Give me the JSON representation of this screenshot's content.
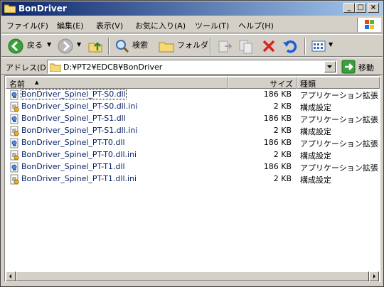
{
  "window": {
    "title": "BonDriver"
  },
  "menu": {
    "items": [
      "ファイル(F)",
      "編集(E)",
      "表示(V)",
      "お気に入り(A)",
      "ツール(T)",
      "ヘルプ(H)"
    ]
  },
  "toolbar": {
    "back_label": "戻る",
    "search_label": "検索",
    "folders_label": "フォルダ"
  },
  "address": {
    "label": "アドレス(D)",
    "value": "D:¥PT2¥EDCB¥BonDriver",
    "go_label": "移動"
  },
  "list": {
    "columns": {
      "name": "名前",
      "size": "サイズ",
      "type": "種類"
    },
    "rows": [
      {
        "name": "BonDriver_Spinel_PT-S0.dll",
        "size": "186 KB",
        "type": "アプリケーション拡張",
        "icon": "dll-icon"
      },
      {
        "name": "BonDriver_Spinel_PT-S0.dll.ini",
        "size": "2 KB",
        "type": "構成設定",
        "icon": "ini-icon"
      },
      {
        "name": "BonDriver_Spinel_PT-S1.dll",
        "size": "186 KB",
        "type": "アプリケーション拡張",
        "icon": "dll-icon"
      },
      {
        "name": "BonDriver_Spinel_PT-S1.dll.ini",
        "size": "2 KB",
        "type": "構成設定",
        "icon": "ini-icon"
      },
      {
        "name": "BonDriver_Spinel_PT-T0.dll",
        "size": "186 KB",
        "type": "アプリケーション拡張",
        "icon": "dll-icon"
      },
      {
        "name": "BonDriver_Spinel_PT-T0.dll.ini",
        "size": "2 KB",
        "type": "構成設定",
        "icon": "ini-icon"
      },
      {
        "name": "BonDriver_Spinel_PT-T1.dll",
        "size": "186 KB",
        "type": "アプリケーション拡張",
        "icon": "dll-icon"
      },
      {
        "name": "BonDriver_Spinel_PT-T1.dll.ini",
        "size": "2 KB",
        "type": "構成設定",
        "icon": "ini-icon"
      }
    ]
  },
  "colors": {
    "title_start": "#0a246a",
    "title_end": "#a6caf0",
    "link": "#0a246a",
    "delete_red": "#e0201a"
  }
}
